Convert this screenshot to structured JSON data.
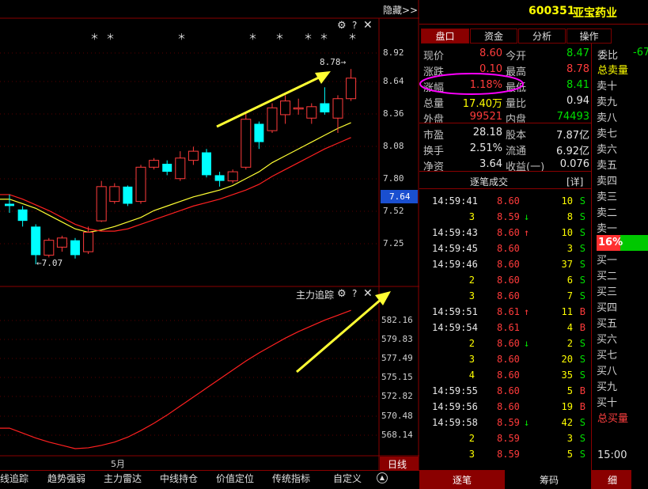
{
  "header": {
    "hide_label": "隐藏>>",
    "stock_code": "600351",
    "stock_name": "亚宝药业"
  },
  "tabs": [
    {
      "label": "盘口",
      "active": true
    },
    {
      "label": "资金",
      "active": false
    },
    {
      "label": "分析",
      "active": false
    },
    {
      "label": "操作",
      "active": false
    }
  ],
  "quote": {
    "rows": [
      {
        "l1": "现价",
        "v1": "8.60",
        "c1": "red",
        "l2": "今开",
        "v2": "8.47",
        "c2": "grn"
      },
      {
        "l1": "涨跌",
        "v1": "0.10",
        "c1": "red",
        "l2": "最高",
        "v2": "8.78",
        "c2": "red"
      },
      {
        "l1": "涨幅",
        "v1": "1.18%",
        "c1": "red",
        "l2": "最低",
        "v2": "8.41",
        "c2": "grn"
      },
      {
        "l1": "总量",
        "v1": "17.40万",
        "c1": "yel",
        "l2": "量比",
        "v2": "0.94",
        "c2": "wht"
      },
      {
        "l1": "外盘",
        "v1": "99521",
        "c1": "red",
        "l2": "内盘",
        "v2": "74493",
        "c2": "grn"
      },
      {
        "l1": "市盈",
        "v1": "28.18",
        "c1": "wht",
        "l2": "股本",
        "v2": "7.87亿",
        "c2": "wht"
      },
      {
        "l1": "换手",
        "v1": "2.51%",
        "c1": "wht",
        "l2": "流通",
        "v2": "6.92亿",
        "c2": "wht"
      },
      {
        "l1": "净资",
        "v1": "3.64",
        "c1": "wht",
        "l2": "收益(一)",
        "v2": "0.076",
        "c2": "wht"
      }
    ]
  },
  "ticks": {
    "title": "逐笔成交",
    "detail_label": "[详]",
    "rows": [
      {
        "time": "14:59:41",
        "vol0": "",
        "price": "8.60",
        "pc": "red",
        "arrow": "",
        "vol": "10",
        "side": "S"
      },
      {
        "time": "",
        "vol0": "3",
        "price": "8.59",
        "pc": "red",
        "arrow": "↓",
        "vol": "8",
        "side": "S"
      },
      {
        "time": "14:59:43",
        "vol0": "",
        "price": "8.60",
        "pc": "red",
        "arrow": "↑",
        "vol": "10",
        "side": "S"
      },
      {
        "time": "14:59:45",
        "vol0": "",
        "price": "8.60",
        "pc": "red",
        "arrow": "",
        "vol": "3",
        "side": "S"
      },
      {
        "time": "14:59:46",
        "vol0": "",
        "price": "8.60",
        "pc": "red",
        "arrow": "",
        "vol": "37",
        "side": "S"
      },
      {
        "time": "",
        "vol0": "2",
        "price": "8.60",
        "pc": "red",
        "arrow": "",
        "vol": "6",
        "side": "S"
      },
      {
        "time": "",
        "vol0": "3",
        "price": "8.60",
        "pc": "red",
        "arrow": "",
        "vol": "7",
        "side": "S"
      },
      {
        "time": "14:59:51",
        "vol0": "",
        "price": "8.61",
        "pc": "red",
        "arrow": "↑",
        "vol": "11",
        "side": "B"
      },
      {
        "time": "14:59:54",
        "vol0": "",
        "price": "8.61",
        "pc": "red",
        "arrow": "",
        "vol": "4",
        "side": "B"
      },
      {
        "time": "",
        "vol0": "2",
        "price": "8.60",
        "pc": "red",
        "arrow": "↓",
        "vol": "2",
        "side": "S"
      },
      {
        "time": "",
        "vol0": "3",
        "price": "8.60",
        "pc": "red",
        "arrow": "",
        "vol": "20",
        "side": "S"
      },
      {
        "time": "",
        "vol0": "4",
        "price": "8.60",
        "pc": "red",
        "arrow": "",
        "vol": "35",
        "side": "S"
      },
      {
        "time": "14:59:55",
        "vol0": "",
        "price": "8.60",
        "pc": "red",
        "arrow": "",
        "vol": "5",
        "side": "B"
      },
      {
        "time": "14:59:56",
        "vol0": "",
        "price": "8.60",
        "pc": "red",
        "arrow": "",
        "vol": "19",
        "side": "B"
      },
      {
        "time": "14:59:58",
        "vol0": "",
        "price": "8.59",
        "pc": "red",
        "arrow": "↓",
        "vol": "42",
        "side": "S"
      },
      {
        "time": "",
        "vol0": "2",
        "price": "8.59",
        "pc": "red",
        "arrow": "",
        "vol": "3",
        "side": "S"
      },
      {
        "time": "",
        "vol0": "3",
        "price": "8.59",
        "pc": "red",
        "arrow": "",
        "vol": "5",
        "side": "S"
      }
    ]
  },
  "book": {
    "weibi_label": "委比",
    "weibi_value": "-67",
    "sell_total": "总卖量",
    "sells": [
      "卖十",
      "卖九",
      "卖八",
      "卖七",
      "卖六",
      "卖五",
      "卖四",
      "卖三",
      "卖二",
      "卖一"
    ],
    "mid_value": "16%",
    "buys": [
      "买一",
      "买二",
      "买三",
      "买四",
      "买五",
      "买六",
      "买七",
      "买八",
      "买九",
      "买十"
    ],
    "buy_total": "总买量",
    "time": "15:00"
  },
  "kline": {
    "price_axis": [
      "8.92",
      "8.64",
      "8.36",
      "8.08",
      "7.80",
      "7.52",
      "7.25"
    ],
    "current_price": "7.64",
    "high_annotation": "8.78",
    "low_annotation": "7.07",
    "candles": [
      {
        "o": 7.6,
        "c": 7.58,
        "h": 7.68,
        "l": 7.52
      },
      {
        "o": 7.55,
        "c": 7.45,
        "h": 7.58,
        "l": 7.4
      },
      {
        "o": 7.4,
        "c": 7.15,
        "h": 7.42,
        "l": 7.07
      },
      {
        "o": 7.15,
        "c": 7.28,
        "h": 7.3,
        "l": 7.13
      },
      {
        "o": 7.22,
        "c": 7.3,
        "h": 7.32,
        "l": 7.18
      },
      {
        "o": 7.28,
        "c": 7.15,
        "h": 7.3,
        "l": 7.12
      },
      {
        "o": 7.18,
        "c": 7.35,
        "h": 7.4,
        "l": 7.16
      },
      {
        "o": 7.45,
        "c": 7.75,
        "h": 7.8,
        "l": 7.44
      },
      {
        "o": 7.62,
        "c": 7.75,
        "h": 7.78,
        "l": 7.6
      },
      {
        "o": 7.75,
        "c": 7.6,
        "h": 7.76,
        "l": 7.58
      },
      {
        "o": 7.62,
        "c": 7.92,
        "h": 7.94,
        "l": 7.6
      },
      {
        "o": 7.92,
        "c": 7.98,
        "h": 8.0,
        "l": 7.9
      },
      {
        "o": 7.95,
        "c": 7.88,
        "h": 7.98,
        "l": 7.85
      },
      {
        "o": 7.82,
        "c": 8.0,
        "h": 8.06,
        "l": 7.8
      },
      {
        "o": 7.98,
        "c": 8.06,
        "h": 8.1,
        "l": 7.94
      },
      {
        "o": 8.05,
        "c": 7.85,
        "h": 8.08,
        "l": 7.83
      },
      {
        "o": 7.85,
        "c": 7.8,
        "h": 7.88,
        "l": 7.75
      },
      {
        "o": 7.8,
        "c": 7.88,
        "h": 7.9,
        "l": 7.78
      },
      {
        "o": 7.92,
        "c": 8.34,
        "h": 8.4,
        "l": 7.9
      },
      {
        "o": 8.3,
        "c": 8.14,
        "h": 8.32,
        "l": 8.08
      },
      {
        "o": 8.24,
        "c": 8.44,
        "h": 8.48,
        "l": 8.22
      },
      {
        "o": 8.38,
        "c": 8.5,
        "h": 8.55,
        "l": 8.3
      },
      {
        "o": 8.44,
        "c": 8.44,
        "h": 8.52,
        "l": 8.38
      },
      {
        "o": 8.35,
        "c": 8.45,
        "h": 8.48,
        "l": 8.3
      },
      {
        "o": 8.48,
        "c": 8.4,
        "h": 8.62,
        "l": 8.38
      },
      {
        "o": 8.35,
        "c": 8.52,
        "h": 8.55,
        "l": 8.22
      },
      {
        "o": 8.52,
        "c": 8.7,
        "h": 8.78,
        "l": 8.5
      }
    ],
    "ma_yellow": [
      7.64,
      7.6,
      7.56,
      7.5,
      7.44,
      7.38,
      7.35,
      7.37,
      7.4,
      7.44,
      7.48,
      7.54,
      7.58,
      7.62,
      7.66,
      7.69,
      7.72,
      7.76,
      7.82,
      7.88,
      7.96,
      8.02,
      8.08,
      8.14,
      8.2,
      8.26,
      8.31
    ],
    "ma_red": [
      7.68,
      7.64,
      7.59,
      7.54,
      7.48,
      7.42,
      7.38,
      7.36,
      7.36,
      7.38,
      7.42,
      7.46,
      7.5,
      7.54,
      7.58,
      7.61,
      7.64,
      7.68,
      7.72,
      7.77,
      7.84,
      7.9,
      7.96,
      8.02,
      8.08,
      8.13,
      8.18
    ]
  },
  "indicator": {
    "title": "主力追踪",
    "axis": [
      "582.16",
      "579.83",
      "577.49",
      "575.15",
      "572.82",
      "570.48",
      "568.14"
    ],
    "values": [
      569.0,
      568.4,
      567.8,
      567.3,
      566.9,
      566.5,
      566.6,
      566.9,
      567.3,
      567.9,
      568.7,
      569.6,
      570.6,
      571.7,
      572.8,
      573.9,
      575.0,
      576.1,
      577.2,
      578.2,
      579.1,
      580.0,
      580.8,
      581.5,
      582.2,
      582.8,
      583.4
    ]
  },
  "x_axis": {
    "month_label": "5月"
  },
  "bottom_tabs": [
    "线追踪",
    "趋势强弱",
    "主力雷达",
    "中线持仓",
    "价值定位",
    "传统指标",
    "自定义"
  ],
  "right_bottom": {
    "daily_label": "日线",
    "tab1": "逐笔",
    "tab2": "筹码",
    "tab3": "细"
  },
  "icons": {
    "gear": "gear-icon",
    "help": "help-icon",
    "close": "close-icon"
  },
  "colors": {
    "up": "#ff3b3b",
    "down": "#00ffff",
    "ma1": "#ffff33",
    "ma2": "#ff2020",
    "indicator": "#ff2020",
    "accent": "#8a0000"
  }
}
